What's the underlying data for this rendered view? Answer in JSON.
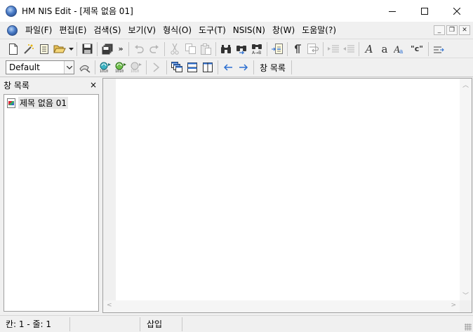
{
  "window": {
    "title": "HM NIS Edit - [제목 없음 01]"
  },
  "menu": {
    "items": [
      "파일(F)",
      "편집(E)",
      "검색(S)",
      "보기(V)",
      "형식(O)",
      "도구(T)",
      "NSIS(N)",
      "창(W)",
      "도움말(?)"
    ]
  },
  "toolbar": {
    "combo_value": "Default",
    "window_list_label": "창 목록",
    "format_symbols": {
      "italic_a": "A",
      "lower_a": "a",
      "quote_c": "\"c\""
    }
  },
  "panel": {
    "title": "창 목록",
    "close": "×",
    "items": [
      "제목 없음 01"
    ]
  },
  "status": {
    "position": "칸: 1 - 줄: 1",
    "mode": "삽입"
  },
  "icons": {
    "app": "nsis-globe-icon",
    "new": "new-file-icon",
    "wizard": "wizard-wand-icon",
    "template": "template-icon",
    "open": "open-folder-icon",
    "save": "save-disk-icon",
    "save_all": "save-all-icon",
    "undo": "undo-icon",
    "redo": "redo-icon",
    "cut": "cut-icon",
    "copy": "copy-icon",
    "paste": "paste-icon",
    "find": "find-binoculars-icon",
    "find_next": "find-next-icon",
    "replace": "replace-icon",
    "goto": "goto-line-icon",
    "whitespace": "pilcrow-icon",
    "wrap": "word-wrap-icon",
    "indent": "indent-icon",
    "outdent": "outdent-icon",
    "compile": "compile-icon",
    "compile_run": "compile-run-icon",
    "stop": "stop-compile-icon",
    "run": "run-icon",
    "cascade": "cascade-icon",
    "tile_h": "tile-horizontal-icon",
    "tile_v": "tile-vertical-icon",
    "prev": "previous-window-icon",
    "next": "next-window-icon"
  },
  "colors": {
    "accent_blue": "#2c6fd1",
    "disabled_gray": "#b5b5b5",
    "background": "#f0f0f0"
  }
}
